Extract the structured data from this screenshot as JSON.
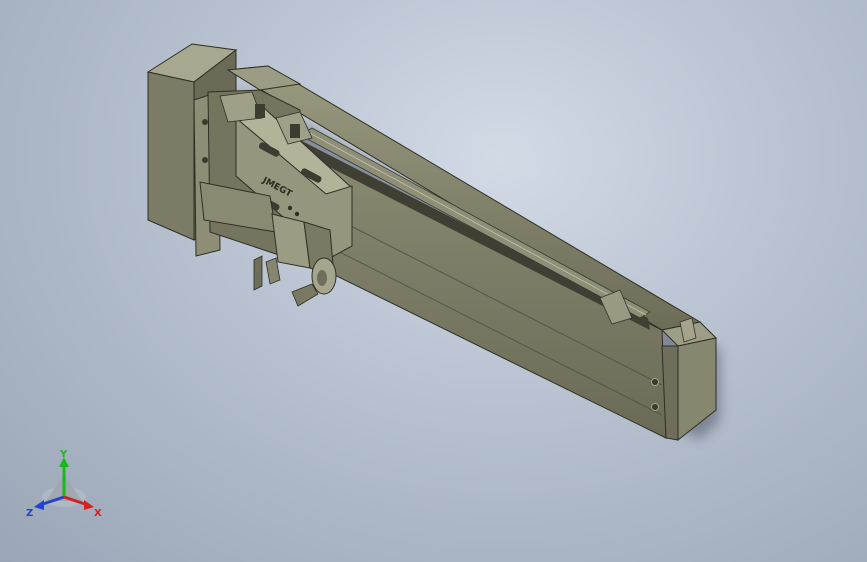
{
  "viewport": {
    "background": "gradient-blue-grey"
  },
  "model": {
    "name_on_carriage": "JMEGT",
    "body_color": "#7f7f68",
    "dark_color": "#4f4f3f",
    "light_color": "#a9a98f"
  },
  "triad": {
    "x_label": "X",
    "y_label": "Y",
    "z_label": "Z",
    "x_color": "#d42020",
    "y_color": "#1fb51f",
    "z_color": "#2244cc"
  }
}
